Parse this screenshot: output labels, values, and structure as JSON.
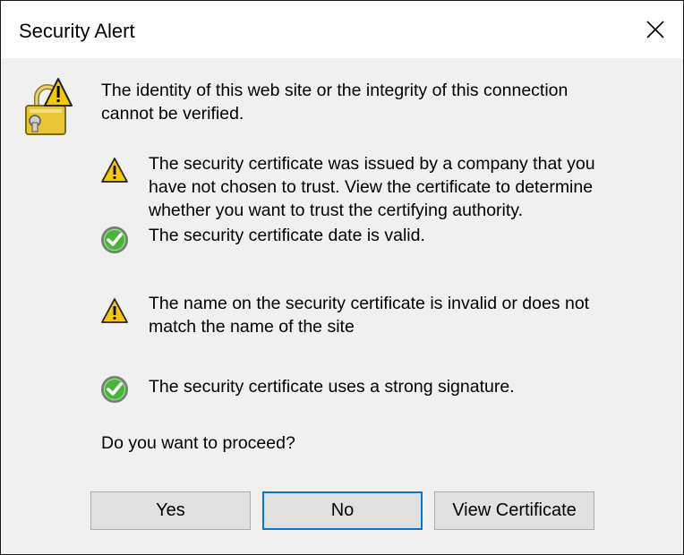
{
  "window": {
    "title": "Security Alert"
  },
  "icons": {
    "header": "lock-warning-icon",
    "warning": "warning-icon",
    "ok": "check-icon"
  },
  "colors": {
    "warning_yellow": "#f5c900",
    "ok_green": "#4ab33b",
    "default_button_border": "#0078d7"
  },
  "message": {
    "line1": "The identity of this web site or the integrity of this connection",
    "line2": "cannot be verified."
  },
  "items": [
    {
      "status": "warning",
      "lines": [
        "The security certificate was issued by a company that you",
        "have not chosen to trust. View the certificate to determine",
        "whether you want to trust the certifying authority."
      ]
    },
    {
      "status": "ok",
      "lines": [
        "The security certificate date is valid."
      ]
    },
    {
      "status": "warning",
      "lines": [
        "The name on the security certificate is invalid or does not",
        "match the name of the site"
      ]
    },
    {
      "status": "ok",
      "lines": [
        "The security certificate uses a strong signature."
      ]
    }
  ],
  "question": "Do you want to proceed?",
  "buttons": {
    "yes": "Yes",
    "no": "No",
    "view_certificate": "View Certificate"
  }
}
